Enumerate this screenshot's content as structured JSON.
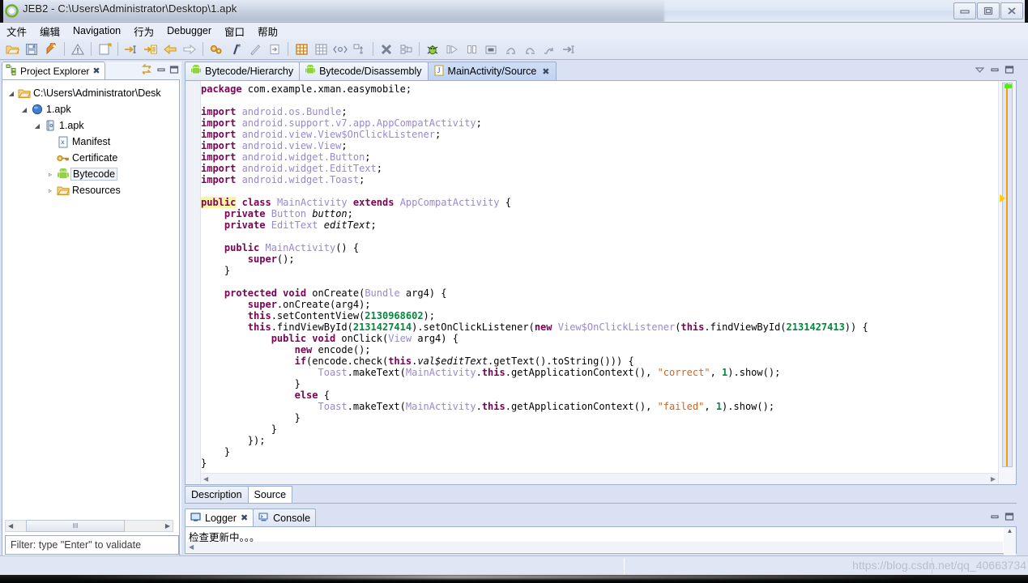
{
  "window": {
    "title": "JEB2 - C:\\Users\\Administrator\\Desktop\\1.apk",
    "app_icon": "jeb-logo-icon",
    "minimize": "–",
    "maximize": "□",
    "close": "✕"
  },
  "menubar": {
    "items": [
      {
        "label": "文件"
      },
      {
        "label": "编辑"
      },
      {
        "label": "Navigation"
      },
      {
        "label": "行为"
      },
      {
        "label": "Debugger"
      },
      {
        "label": "窗口"
      },
      {
        "label": "帮助"
      }
    ]
  },
  "toolbar": {
    "groups": [
      [
        "open-folder-icon",
        "save-icon",
        "wrench-icon"
      ],
      [
        "warning-icon"
      ],
      [
        "new-document-icon"
      ],
      [
        "goto-address-icon",
        "goto-reference-icon",
        "navigate-back-icon",
        "navigate-forward-icon"
      ],
      [
        "gears-icon",
        "comment-icon",
        "rename-icon",
        "export-icon"
      ],
      [
        "grid-orange-icon",
        "grid-gray-icon",
        "code-tag-icon",
        "hierarchy-icon"
      ],
      [
        "terminate-icon",
        "diff-icon"
      ],
      [
        "debug-bug-icon",
        "resume-icon",
        "pause-icon",
        "stop-icon",
        "step-over-icon",
        "step-return-icon",
        "step-into-icon",
        "run-to-line-icon"
      ]
    ]
  },
  "project_explorer": {
    "tab_label": "Project Explorer",
    "tab_icon": "project-explorer-icon",
    "tab_close": "✖",
    "tools": [
      "link-with-editor-icon",
      "minimize-icon",
      "maximize-icon"
    ],
    "tree": [
      {
        "indent": 0,
        "arrow": "◢",
        "icon": "folder-icon",
        "label": "C:\\Users\\Administrator\\Desk",
        "selected": false
      },
      {
        "indent": 1,
        "arrow": "◢",
        "icon": "blue-sphere-icon",
        "label": "1.apk",
        "selected": false
      },
      {
        "indent": 2,
        "arrow": "◢",
        "icon": "apk-package-icon",
        "label": "1.apk",
        "selected": false
      },
      {
        "indent": 3,
        "arrow": "",
        "icon": "xml-manifest-icon",
        "label": "Manifest",
        "selected": false
      },
      {
        "indent": 3,
        "arrow": "",
        "icon": "key-certificate-icon",
        "label": "Certificate",
        "selected": false
      },
      {
        "indent": 3,
        "arrow": "▹",
        "icon": "android-bytecode-icon",
        "label": "Bytecode",
        "selected": true
      },
      {
        "indent": 3,
        "arrow": "▹",
        "icon": "folder-resources-icon",
        "label": "Resources",
        "selected": false
      }
    ],
    "hscroll": {
      "left_arrow": "◀",
      "right_arrow": "▶",
      "grip": "‖‖"
    },
    "filter_placeholder": "Filter: type \"Enter\" to validate",
    "filter_value": ""
  },
  "editor": {
    "tabs": [
      {
        "label": "Bytecode/Hierarchy",
        "icon": "android-icon",
        "active": false,
        "closable": false
      },
      {
        "label": "Bytecode/Disassembly",
        "icon": "android-icon",
        "active": false,
        "closable": false
      },
      {
        "label": "MainActivity/Source",
        "icon": "java-source-icon",
        "active": true,
        "closable": true,
        "close_glyph": "✖"
      }
    ],
    "tools": [
      "view-menu-icon",
      "minimize-icon",
      "maximize-icon"
    ],
    "sub_tabs": [
      {
        "label": "Description",
        "active": false
      },
      {
        "label": "Source",
        "active": true
      }
    ],
    "hscroll": {
      "left_arrow": "◀",
      "right_arrow": "▶"
    },
    "code_lines": [
      [
        {
          "t": "package ",
          "c": "kw"
        },
        {
          "t": "com.example.xman.easymobile;",
          "c": "plain"
        }
      ],
      [],
      [
        {
          "t": "import ",
          "c": "kw"
        },
        {
          "t": "android.os.Bundle",
          "c": "typ"
        },
        {
          "t": ";",
          "c": "plain"
        }
      ],
      [
        {
          "t": "import ",
          "c": "kw"
        },
        {
          "t": "android.support.v7.app.AppCompatActivity",
          "c": "typ"
        },
        {
          "t": ";",
          "c": "plain"
        }
      ],
      [
        {
          "t": "import ",
          "c": "kw"
        },
        {
          "t": "android.view.View$OnClickListener",
          "c": "typ"
        },
        {
          "t": ";",
          "c": "plain"
        }
      ],
      [
        {
          "t": "import ",
          "c": "kw"
        },
        {
          "t": "android.view.View",
          "c": "typ"
        },
        {
          "t": ";",
          "c": "plain"
        }
      ],
      [
        {
          "t": "import ",
          "c": "kw"
        },
        {
          "t": "android.widget.Button",
          "c": "typ"
        },
        {
          "t": ";",
          "c": "plain"
        }
      ],
      [
        {
          "t": "import ",
          "c": "kw"
        },
        {
          "t": "android.widget.EditText",
          "c": "typ"
        },
        {
          "t": ";",
          "c": "plain"
        }
      ],
      [
        {
          "t": "import ",
          "c": "kw"
        },
        {
          "t": "android.widget.Toast",
          "c": "typ"
        },
        {
          "t": ";",
          "c": "plain"
        }
      ],
      [],
      [
        {
          "t": "public",
          "c": "kw hlbox"
        },
        {
          "t": " ",
          "c": "plain"
        },
        {
          "t": "class",
          "c": "kw"
        },
        {
          "t": " ",
          "c": "plain"
        },
        {
          "t": "MainActivity",
          "c": "typ"
        },
        {
          "t": " ",
          "c": "plain"
        },
        {
          "t": "extends",
          "c": "kw"
        },
        {
          "t": " ",
          "c": "plain"
        },
        {
          "t": "AppCompatActivity",
          "c": "typ"
        },
        {
          "t": " {",
          "c": "plain"
        }
      ],
      [
        {
          "t": "    ",
          "c": "plain"
        },
        {
          "t": "private",
          "c": "kw"
        },
        {
          "t": " ",
          "c": "plain"
        },
        {
          "t": "Button",
          "c": "typ"
        },
        {
          "t": " ",
          "c": "plain"
        },
        {
          "t": "button",
          "c": "ital"
        },
        {
          "t": ";",
          "c": "plain"
        }
      ],
      [
        {
          "t": "    ",
          "c": "plain"
        },
        {
          "t": "private",
          "c": "kw"
        },
        {
          "t": " ",
          "c": "plain"
        },
        {
          "t": "EditText",
          "c": "typ"
        },
        {
          "t": " ",
          "c": "plain"
        },
        {
          "t": "editText",
          "c": "ital"
        },
        {
          "t": ";",
          "c": "plain"
        }
      ],
      [],
      [
        {
          "t": "    ",
          "c": "plain"
        },
        {
          "t": "public",
          "c": "kw"
        },
        {
          "t": " ",
          "c": "plain"
        },
        {
          "t": "MainActivity",
          "c": "typ"
        },
        {
          "t": "() {",
          "c": "plain"
        }
      ],
      [
        {
          "t": "        ",
          "c": "plain"
        },
        {
          "t": "super",
          "c": "kw"
        },
        {
          "t": "();",
          "c": "plain"
        }
      ],
      [
        {
          "t": "    }",
          "c": "plain"
        }
      ],
      [],
      [
        {
          "t": "    ",
          "c": "plain"
        },
        {
          "t": "protected",
          "c": "kw"
        },
        {
          "t": " ",
          "c": "plain"
        },
        {
          "t": "void",
          "c": "kw"
        },
        {
          "t": " onCreate(",
          "c": "plain"
        },
        {
          "t": "Bundle",
          "c": "typ"
        },
        {
          "t": " arg4) {",
          "c": "plain"
        }
      ],
      [
        {
          "t": "        ",
          "c": "plain"
        },
        {
          "t": "super",
          "c": "kw"
        },
        {
          "t": ".onCreate(arg4);",
          "c": "plain"
        }
      ],
      [
        {
          "t": "        ",
          "c": "plain"
        },
        {
          "t": "this",
          "c": "kw"
        },
        {
          "t": ".setContentView(",
          "c": "plain"
        },
        {
          "t": "2130968602",
          "c": "num"
        },
        {
          "t": ");",
          "c": "plain"
        }
      ],
      [
        {
          "t": "        ",
          "c": "plain"
        },
        {
          "t": "this",
          "c": "kw"
        },
        {
          "t": ".findViewById(",
          "c": "plain"
        },
        {
          "t": "2131427414",
          "c": "num"
        },
        {
          "t": ").setOnClickListener(",
          "c": "plain"
        },
        {
          "t": "new",
          "c": "kw"
        },
        {
          "t": " ",
          "c": "plain"
        },
        {
          "t": "View$OnClickListener",
          "c": "typ"
        },
        {
          "t": "(",
          "c": "plain"
        },
        {
          "t": "this",
          "c": "kw"
        },
        {
          "t": ".findViewById(",
          "c": "plain"
        },
        {
          "t": "2131427413",
          "c": "num"
        },
        {
          "t": ")) {",
          "c": "plain"
        }
      ],
      [
        {
          "t": "            ",
          "c": "plain"
        },
        {
          "t": "public",
          "c": "kw"
        },
        {
          "t": " ",
          "c": "plain"
        },
        {
          "t": "void",
          "c": "kw"
        },
        {
          "t": " onClick(",
          "c": "plain"
        },
        {
          "t": "View",
          "c": "typ"
        },
        {
          "t": " arg4) {",
          "c": "plain"
        }
      ],
      [
        {
          "t": "                ",
          "c": "plain"
        },
        {
          "t": "new",
          "c": "kw"
        },
        {
          "t": " encode();",
          "c": "plain"
        }
      ],
      [
        {
          "t": "                ",
          "c": "plain"
        },
        {
          "t": "if",
          "c": "kw"
        },
        {
          "t": "(encode.check(",
          "c": "plain"
        },
        {
          "t": "this",
          "c": "kw"
        },
        {
          "t": ".",
          "c": "plain"
        },
        {
          "t": "val$editText",
          "c": "ital"
        },
        {
          "t": ".getText().toString())) {",
          "c": "plain"
        }
      ],
      [
        {
          "t": "                    ",
          "c": "plain"
        },
        {
          "t": "Toast",
          "c": "typ"
        },
        {
          "t": ".makeText(",
          "c": "plain"
        },
        {
          "t": "MainActivity",
          "c": "typ"
        },
        {
          "t": ".",
          "c": "plain"
        },
        {
          "t": "this",
          "c": "kw"
        },
        {
          "t": ".getApplicationContext(), ",
          "c": "plain"
        },
        {
          "t": "\"correct\"",
          "c": "str"
        },
        {
          "t": ", ",
          "c": "plain"
        },
        {
          "t": "1",
          "c": "num"
        },
        {
          "t": ").show();",
          "c": "plain"
        }
      ],
      [
        {
          "t": "                }",
          "c": "plain"
        }
      ],
      [
        {
          "t": "                ",
          "c": "plain"
        },
        {
          "t": "else",
          "c": "kw"
        },
        {
          "t": " {",
          "c": "plain"
        }
      ],
      [
        {
          "t": "                    ",
          "c": "plain"
        },
        {
          "t": "Toast",
          "c": "typ"
        },
        {
          "t": ".makeText(",
          "c": "plain"
        },
        {
          "t": "MainActivity",
          "c": "typ"
        },
        {
          "t": ".",
          "c": "plain"
        },
        {
          "t": "this",
          "c": "kw"
        },
        {
          "t": ".getApplicationContext(), ",
          "c": "plain"
        },
        {
          "t": "\"failed\"",
          "c": "str"
        },
        {
          "t": ", ",
          "c": "plain"
        },
        {
          "t": "1",
          "c": "num"
        },
        {
          "t": ").show();",
          "c": "plain"
        }
      ],
      [
        {
          "t": "                }",
          "c": "plain"
        }
      ],
      [
        {
          "t": "            }",
          "c": "plain"
        }
      ],
      [
        {
          "t": "        });",
          "c": "plain"
        }
      ],
      [
        {
          "t": "    }",
          "c": "plain"
        }
      ],
      [
        {
          "t": "}",
          "c": "plain"
        }
      ]
    ]
  },
  "logger": {
    "tabs": [
      {
        "label": "Logger",
        "icon": "logger-icon",
        "active": true,
        "close_glyph": "✖"
      },
      {
        "label": "Console",
        "icon": "console-icon",
        "active": false
      }
    ],
    "tools": [
      "minimize-icon",
      "maximize-icon"
    ],
    "message": "检查更新中。。。",
    "hscroll_left": "◀",
    "vscroll_up": "▲",
    "vscroll_down": "▼"
  },
  "statusbar": {
    "watermark": "https://blog.csdn.net/qq_40663734"
  },
  "colors": {
    "keyword": "#7f0055",
    "type": "#9a86d6",
    "number": "#008a3c",
    "string": "#e06010",
    "highlight": "#fbf5a8",
    "chrome": "#dfe6f4",
    "accent": "#f5a000"
  }
}
